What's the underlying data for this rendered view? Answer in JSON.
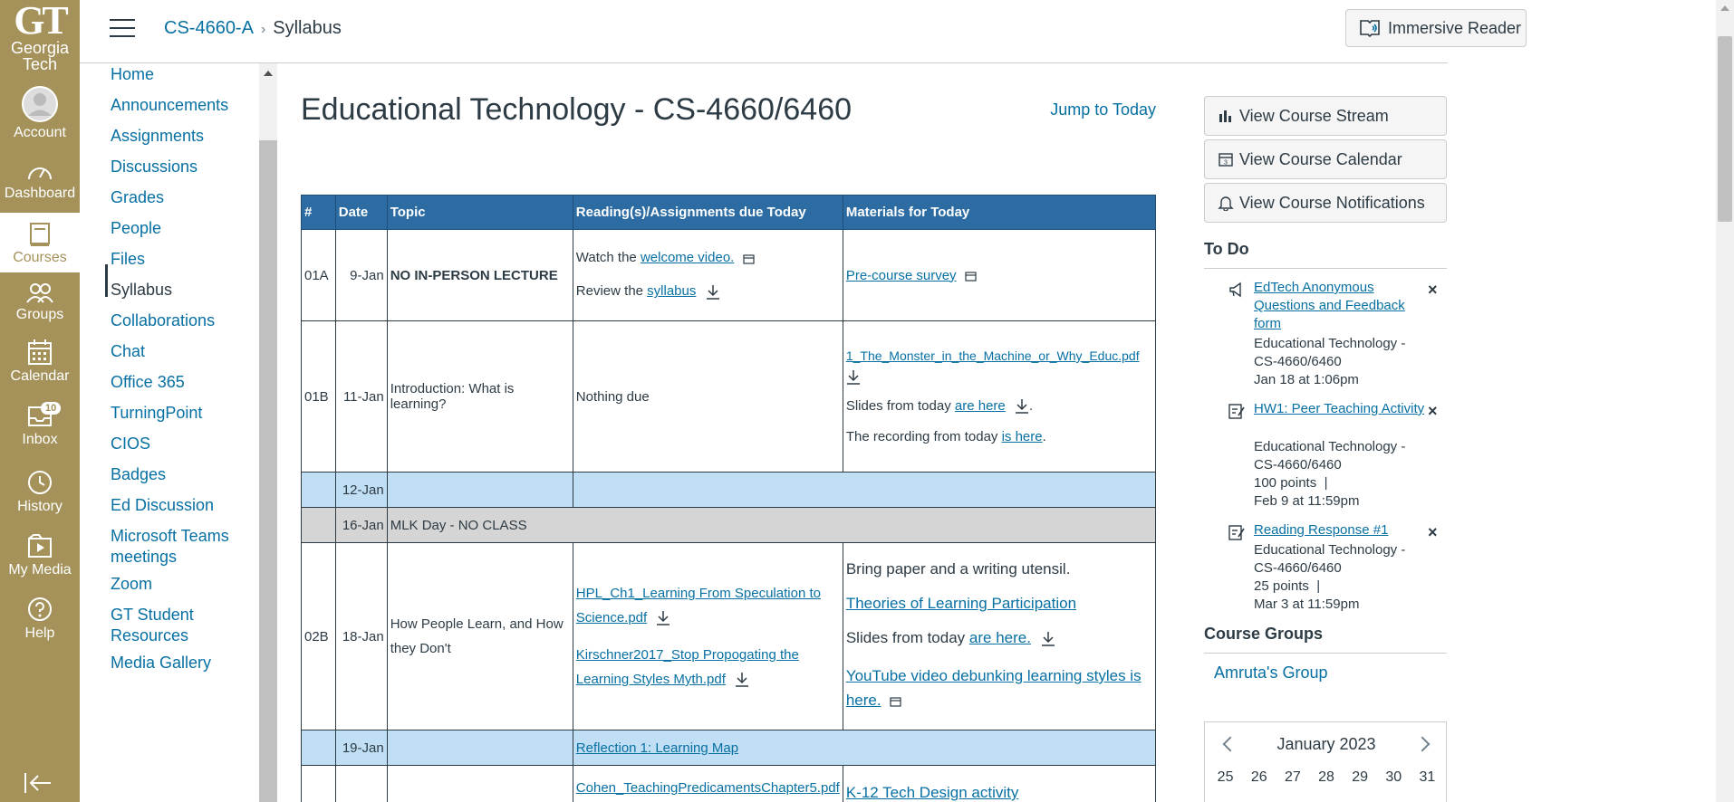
{
  "global_nav": {
    "logo_mark": "GT",
    "logo_name": "Georgia Tech",
    "items": [
      {
        "label": "Account",
        "icon": "account-icon"
      },
      {
        "label": "Dashboard",
        "icon": "dashboard-icon"
      },
      {
        "label": "Courses",
        "icon": "courses-icon",
        "active": true
      },
      {
        "label": "Groups",
        "icon": "groups-icon"
      },
      {
        "label": "Calendar",
        "icon": "calendar-icon"
      },
      {
        "label": "Inbox",
        "icon": "inbox-icon",
        "badge": "10"
      },
      {
        "label": "History",
        "icon": "history-icon"
      },
      {
        "label": "My Media",
        "icon": "my-media-icon"
      },
      {
        "label": "Help",
        "icon": "help-icon"
      }
    ],
    "brand_color": "#a4925a"
  },
  "header": {
    "course_code": "CS-4660-A",
    "separator": "›",
    "current_page": "Syllabus",
    "immersive_reader": "Immersive Reader"
  },
  "course_nav": {
    "items": [
      "Home",
      "Announcements",
      "Assignments",
      "Discussions",
      "Grades",
      "People",
      "Files",
      "Syllabus",
      "Collaborations",
      "Chat",
      "Office 365",
      "TurningPoint",
      "CIOS",
      "Badges",
      "Ed Discussion",
      "Microsoft Teams meetings",
      "Zoom",
      "GT Student Resources",
      "Media Gallery"
    ],
    "active": "Syllabus"
  },
  "main": {
    "title": "Educational Technology - CS-4660/6460",
    "jump_to_today": "Jump to Today",
    "table": {
      "headers": [
        "#",
        "Date",
        "Topic",
        "Reading(s)/Assignments due Today",
        "Materials for Today"
      ],
      "header_color": "#2c6ca3",
      "rows": {
        "r1": {
          "num": "01A",
          "date": "9-Jan",
          "topic": "NO IN-PERSON LECTURE",
          "reading_1_prefix": "Watch the",
          "reading_1_link": "welcome video.",
          "reading_2_prefix": "Review the",
          "reading_2_link": "syllabus",
          "material_1_link": "Pre-course survey"
        },
        "r2": {
          "num": "01B",
          "date": "11-Jan",
          "topic": "Introduction: What is learning?",
          "reading": "Nothing due",
          "material_1_link": "1_The_Monster_in_the_Machine_or_Why_Educ.pdf",
          "material_2_prefix": "Slides from today",
          "material_2_link": "are here",
          "material_2_suffix": ".",
          "material_3_prefix": "The recording from today",
          "material_3_link": "is here",
          "material_3_suffix": "."
        },
        "r3": {
          "date": "12-Jan"
        },
        "r4": {
          "date": "16-Jan",
          "topic": "MLK Day - NO CLASS"
        },
        "r5": {
          "num": "02B",
          "date": "18-Jan",
          "topic": "How People Learn, and How they Don't",
          "reading_1_link": "HPL_Ch1_Learning From Speculation to Science.pdf",
          "reading_2_link": "Kirschner2017_Stop Propogating the Learning Styles Myth.pdf",
          "material_1": "Bring paper and a writing utensil.",
          "material_2_link": "Theories of Learning Participation",
          "material_3_prefix": "Slides from today",
          "material_3_link": "are here.",
          "material_4_link": "YouTube video debunking learning styles is here."
        },
        "r6": {
          "date": "19-Jan",
          "reading_link": "Reflection 1: Learning Map"
        },
        "r7": {
          "reading_link": "Cohen_TeachingPredicamentsChapter5.pdf",
          "material_link": "K-12 Tech Design activity"
        }
      }
    }
  },
  "sidebar": {
    "buttons": [
      "View Course Stream",
      "View Course Calendar",
      "View Course Notifications"
    ],
    "todo_title": "To Do",
    "todos": [
      {
        "title": "EdTech Anonymous Questions and Feedback form",
        "course": "Educational Technology - CS-4660/6460",
        "due": "Jan 18 at 1:06pm",
        "icon": "announcement-icon"
      },
      {
        "title": "HW1: Peer Teaching Activity",
        "course": "Educational Technology - CS-4660/6460",
        "points": "100 points",
        "pipe": "|",
        "due": "Feb 9 at 11:59pm",
        "icon": "assignment-icon"
      },
      {
        "title": "Reading Response #1",
        "course": "Educational Technology - CS-4660/6460",
        "points": "25 points",
        "pipe": "|",
        "due": "Mar 3 at 11:59pm",
        "icon": "assignment-icon"
      }
    ],
    "dismiss": "×",
    "groups_title": "Course Groups",
    "group": "Amruta's Group",
    "calendar": {
      "month": "January 2023",
      "days": [
        "25",
        "26",
        "27",
        "28",
        "29",
        "30",
        "31"
      ]
    }
  }
}
